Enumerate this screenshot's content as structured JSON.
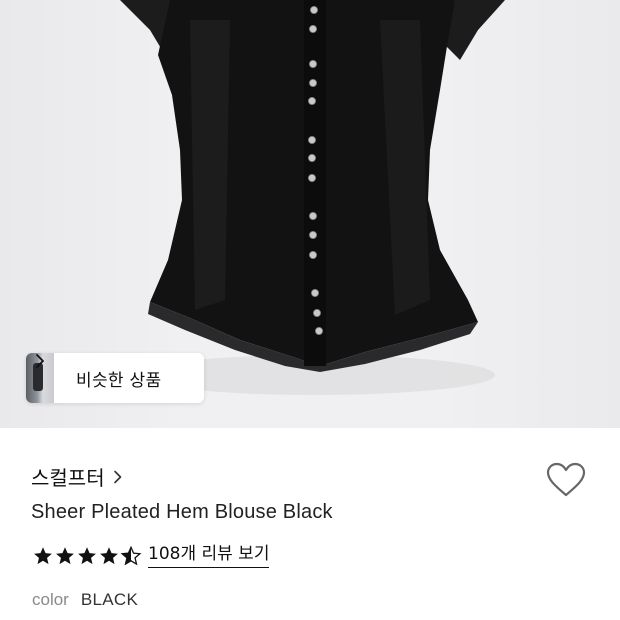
{
  "product_image": {
    "alt": "Sheer Pleated Hem Blouse Black"
  },
  "similar_products": {
    "label": "비슷한 상품"
  },
  "brand": {
    "name": "스컬프터"
  },
  "product": {
    "title": "Sheer Pleated Hem Blouse Black",
    "rating": 4.5,
    "review_link": "108개 리뷰 보기"
  },
  "color": {
    "label": "color",
    "value": "BLACK"
  }
}
